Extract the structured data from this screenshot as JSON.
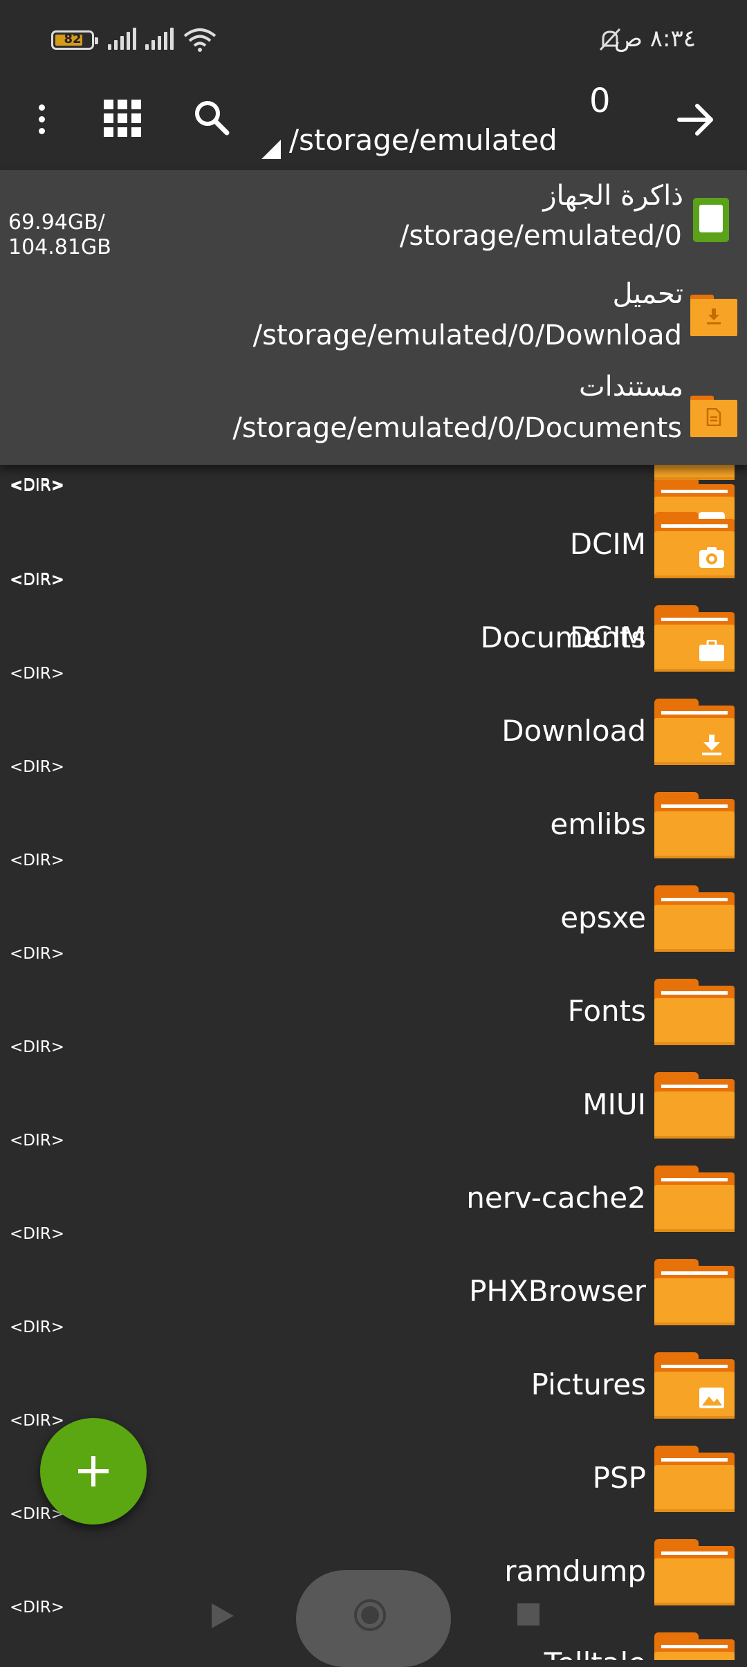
{
  "status_bar": {
    "battery": "82",
    "time": "٨:٣٤ ص"
  },
  "toolbar": {
    "selected_count": "0",
    "current_path": "/storage/emulated"
  },
  "locations": [
    {
      "title": "ذاكرة الجهاز",
      "path": "/storage/emulated/0",
      "size_free": "69.94GB/",
      "size_total": "104.81GB",
      "icon": "sd-storage-icon"
    },
    {
      "title": "تحميل",
      "path": "/storage/emulated/0/Download",
      "icon": "download-folder-icon"
    },
    {
      "title": "مستندات",
      "path": "/storage/emulated/0/Documents",
      "icon": "documents-folder-icon"
    }
  ],
  "file_list": {
    "dir_label": "<DIR>",
    "items": [
      {
        "name": "",
        "icon": "folder-icon"
      },
      {
        "name": "DCIM",
        "icon": "camera-folder-icon"
      },
      {
        "name": "Documents",
        "icon": "briefcase-folder-icon"
      },
      {
        "name": "Download",
        "icon": "download-folder-icon"
      },
      {
        "name": "emlibs",
        "icon": "folder-icon"
      },
      {
        "name": "epsxe",
        "icon": "folder-icon"
      },
      {
        "name": "Fonts",
        "icon": "folder-icon"
      },
      {
        "name": "MIUI",
        "icon": "folder-icon"
      },
      {
        "name": "nerv-cache2",
        "icon": "folder-icon"
      },
      {
        "name": "PHXBrowser",
        "icon": "folder-icon"
      },
      {
        "name": "Pictures",
        "icon": "image-folder-icon"
      },
      {
        "name": "PSP",
        "icon": "folder-icon"
      },
      {
        "name": "ramdump",
        "icon": "folder-icon"
      },
      {
        "name": "Telltale",
        "icon": "folder-icon"
      }
    ]
  },
  "colors": {
    "background": "#2b2b2b",
    "dropdown": "#424242",
    "folder": "#f7a325",
    "folder_dark": "#e8720a",
    "accent_green": "#5aa711"
  }
}
